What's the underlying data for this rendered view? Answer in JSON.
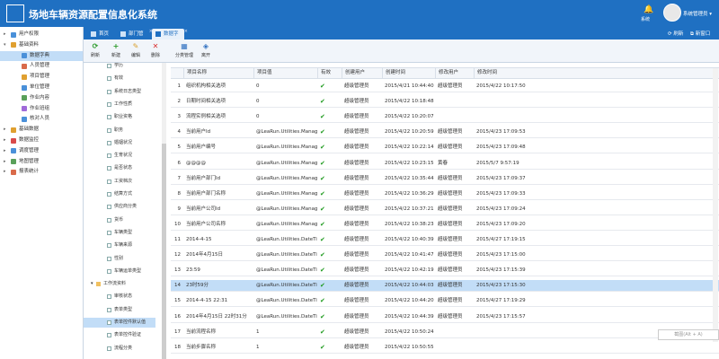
{
  "header": {
    "title": "场地车辆资源配置信息化系统",
    "bell_label": "系统",
    "user_name": "系统管理员 ▾"
  },
  "sidebar": {
    "items": [
      {
        "label": "用户权限",
        "caret": "▸",
        "indent": 0,
        "color": "#4a90d9"
      },
      {
        "label": "基础资料",
        "caret": "▾",
        "indent": 0,
        "color": "#e0a030"
      },
      {
        "label": "数据字典",
        "caret": "",
        "indent": 1,
        "color": "#4a90d9",
        "active": true
      },
      {
        "label": "人员管理",
        "caret": "",
        "indent": 1,
        "color": "#d96a4a"
      },
      {
        "label": "项目管理",
        "caret": "",
        "indent": 1,
        "color": "#e0a030"
      },
      {
        "label": "单位管理",
        "caret": "",
        "indent": 1,
        "color": "#4a90d9"
      },
      {
        "label": "作业内容",
        "caret": "",
        "indent": 1,
        "color": "#5aa05a"
      },
      {
        "label": "作业班组",
        "caret": "",
        "indent": 1,
        "color": "#a06ad9"
      },
      {
        "label": "核对人员",
        "caret": "",
        "indent": 1,
        "color": "#4a90d9"
      },
      {
        "label": "基础数据",
        "caret": "▸",
        "indent": 0,
        "color": "#e0a030"
      },
      {
        "label": "数据监控",
        "caret": "▸",
        "indent": 0,
        "color": "#d94a4a"
      },
      {
        "label": "调度管理",
        "caret": "▸",
        "indent": 0,
        "color": "#4a90d9"
      },
      {
        "label": "地图管理",
        "caret": "▸",
        "indent": 0,
        "color": "#5aa05a"
      },
      {
        "label": "报表统计",
        "caret": "▸",
        "indent": 0,
        "color": "#d96a4a"
      }
    ]
  },
  "tabs": [
    {
      "label": "首页",
      "active": false,
      "closable": false
    },
    {
      "label": "部门管理",
      "active": false,
      "closable": true
    },
    {
      "label": "数据字典",
      "active": true,
      "closable": true
    }
  ],
  "tab_right": {
    "refresh": "刷新",
    "new_window": "新窗口"
  },
  "toolbar": {
    "buttons": [
      {
        "label": "刷新",
        "icon": "refresh-icon",
        "glyph": "⟳",
        "color": "#2a9a2a"
      },
      {
        "label": "新建",
        "icon": "add-icon",
        "glyph": "+",
        "color": "#2a9a2a"
      },
      {
        "label": "编辑",
        "icon": "edit-icon",
        "glyph": "✎",
        "color": "#d9a030"
      },
      {
        "label": "删除",
        "icon": "delete-icon",
        "glyph": "✕",
        "color": "#d93030"
      },
      {
        "label": "分类管理",
        "icon": "category-icon",
        "glyph": "▦",
        "color": "#3070c0"
      },
      {
        "label": "离开",
        "icon": "exit-icon",
        "glyph": "◈",
        "color": "#3070c0"
      }
    ]
  },
  "tree": {
    "items": [
      {
        "label": "学历",
        "type": "leaf"
      },
      {
        "label": "有效",
        "type": "leaf"
      },
      {
        "label": "系统日志类型",
        "type": "leaf"
      },
      {
        "label": "工作性质",
        "type": "leaf"
      },
      {
        "label": "职业资格",
        "type": "leaf"
      },
      {
        "label": "职务",
        "type": "leaf"
      },
      {
        "label": "婚姻状况",
        "type": "leaf"
      },
      {
        "label": "生育状况",
        "type": "leaf"
      },
      {
        "label": "是否状态",
        "type": "leaf"
      },
      {
        "label": "工资档次",
        "type": "leaf"
      },
      {
        "label": "结算方式",
        "type": "leaf"
      },
      {
        "label": "供应商分类",
        "type": "leaf"
      },
      {
        "label": "货币",
        "type": "leaf"
      },
      {
        "label": "车辆类型",
        "type": "leaf"
      },
      {
        "label": "车辆来源",
        "type": "leaf"
      },
      {
        "label": "性别",
        "type": "leaf"
      },
      {
        "label": "车辆运单类型",
        "type": "leaf"
      },
      {
        "label": "工作流资料",
        "type": "folder"
      },
      {
        "label": "审核状态",
        "type": "leaf"
      },
      {
        "label": "表单类型",
        "type": "leaf"
      },
      {
        "label": "表单控件默认值",
        "type": "leaf",
        "active": true
      },
      {
        "label": "表单控件验证",
        "type": "leaf"
      },
      {
        "label": "流程分类",
        "type": "leaf"
      }
    ]
  },
  "grid": {
    "columns": [
      "项目名称",
      "项目值",
      "有效",
      "创建用户",
      "创建时间",
      "修改用户",
      "修改时间"
    ],
    "rows": [
      {
        "n": "1",
        "name": "组织机构相关选项",
        "value": "0",
        "valid": true,
        "cu": "超级管理员",
        "ct": "2015/4/21 10:44:40",
        "mu": "超级管理员",
        "mt": "2015/4/22 10:17:50"
      },
      {
        "n": "2",
        "name": "日期时间相关选项",
        "value": "0",
        "valid": true,
        "cu": "超级管理员",
        "ct": "2015/4/22 10:18:48",
        "mu": "",
        "mt": ""
      },
      {
        "n": "3",
        "name": "流程实例相关选项",
        "value": "0",
        "valid": true,
        "cu": "超级管理员",
        "ct": "2015/4/22 10:20:07",
        "mu": "",
        "mt": ""
      },
      {
        "n": "4",
        "name": "当前用户Id",
        "value": "@LeaRun.Utilities.Manag...",
        "valid": true,
        "cu": "超级管理员",
        "ct": "2015/4/22 10:20:59",
        "mu": "超级管理员",
        "mt": "2015/4/23 17:09:53"
      },
      {
        "n": "5",
        "name": "当前用户编号",
        "value": "@LeaRun.Utilities.Manag...",
        "valid": true,
        "cu": "超级管理员",
        "ct": "2015/4/22 10:22:14",
        "mu": "超级管理员",
        "mt": "2015/4/23 17:09:48"
      },
      {
        "n": "6",
        "name": "@@@@",
        "value": "@LeaRun.Utilities.Manag...",
        "valid": true,
        "cu": "超级管理员",
        "ct": "2015/4/22 10:23:15",
        "mu": "黄春",
        "mt": "2015/5/7 9:57:19"
      },
      {
        "n": "7",
        "name": "当前用户部门Id",
        "value": "@LeaRun.Utilities.Manag...",
        "valid": true,
        "cu": "超级管理员",
        "ct": "2015/4/22 10:35:44",
        "mu": "超级管理员",
        "mt": "2015/4/23 17:09:37"
      },
      {
        "n": "8",
        "name": "当前用户部门名称",
        "value": "@LeaRun.Utilities.Manag...",
        "valid": true,
        "cu": "超级管理员",
        "ct": "2015/4/22 10:36:29",
        "mu": "超级管理员",
        "mt": "2015/4/23 17:09:33"
      },
      {
        "n": "9",
        "name": "当前用户公司Id",
        "value": "@LeaRun.Utilities.Manag...",
        "valid": true,
        "cu": "超级管理员",
        "ct": "2015/4/22 10:37:21",
        "mu": "超级管理员",
        "mt": "2015/4/23 17:09:24"
      },
      {
        "n": "10",
        "name": "当前用户公司名称",
        "value": "@LeaRun.Utilities.Manag...",
        "valid": true,
        "cu": "超级管理员",
        "ct": "2015/4/22 10:38:23",
        "mu": "超级管理员",
        "mt": "2015/4/23 17:09:20"
      },
      {
        "n": "11",
        "name": "2014-4-15",
        "value": "@LeaRun.Utilities.DateTi...",
        "valid": true,
        "cu": "超级管理员",
        "ct": "2015/4/22 10:40:39",
        "mu": "超级管理员",
        "mt": "2015/4/27 17:19:15"
      },
      {
        "n": "12",
        "name": "2014年4月15日",
        "value": "@LeaRun.Utilities.DateTi...",
        "valid": true,
        "cu": "超级管理员",
        "ct": "2015/4/22 10:41:47",
        "mu": "超级管理员",
        "mt": "2015/4/23 17:15:00"
      },
      {
        "n": "13",
        "name": "23:59",
        "value": "@LeaRun.Utilities.DateTi...",
        "valid": true,
        "cu": "超级管理员",
        "ct": "2015/4/22 10:42:19",
        "mu": "超级管理员",
        "mt": "2015/4/23 17:15:39"
      },
      {
        "n": "14",
        "name": "23时59分",
        "value": "@LeaRun.Utilities.DateTi...",
        "valid": true,
        "cu": "超级管理员",
        "ct": "2015/4/22 10:44:03",
        "mu": "超级管理员",
        "mt": "2015/4/23 17:15:30",
        "sel": true
      },
      {
        "n": "15",
        "name": "2014-4-15 22:31",
        "value": "@LeaRun.Utilities.DateTi...",
        "valid": true,
        "cu": "超级管理员",
        "ct": "2015/4/22 10:44:20",
        "mu": "超级管理员",
        "mt": "2015/4/27 17:19:29"
      },
      {
        "n": "16",
        "name": "2014年4月15日 22时31分",
        "value": "@LeaRun.Utilities.DateTi...",
        "valid": true,
        "cu": "超级管理员",
        "ct": "2015/4/22 10:44:39",
        "mu": "超级管理员",
        "mt": "2015/4/23 17:15:57"
      },
      {
        "n": "17",
        "name": "当前流程名称",
        "value": "1",
        "valid": true,
        "cu": "超级管理员",
        "ct": "2015/4/22 10:50:24",
        "mu": "",
        "mt": ""
      },
      {
        "n": "18",
        "name": "当前步骤名称",
        "value": "1",
        "valid": true,
        "cu": "超级管理员",
        "ct": "2015/4/22 10:50:55",
        "mu": "",
        "mt": ""
      }
    ]
  },
  "screenshot_hint": "截图(Alt + A)"
}
